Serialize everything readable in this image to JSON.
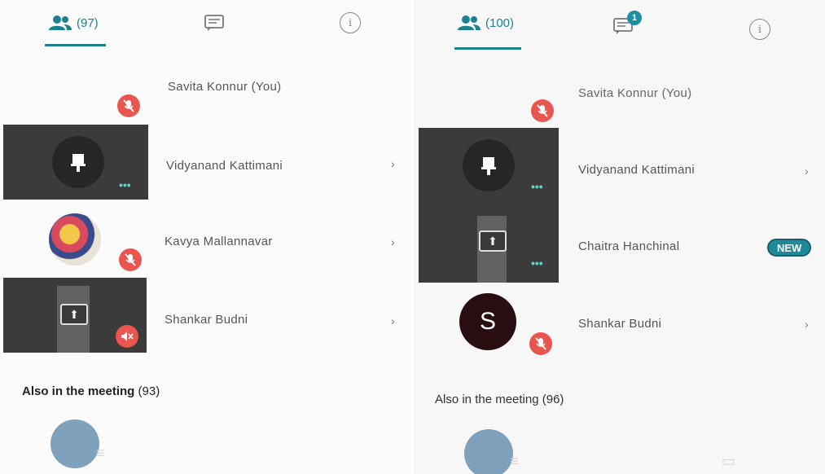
{
  "left": {
    "participants_tab": {
      "count": "(97)"
    },
    "participants": [
      {
        "name": "Savita Konnur (You)"
      },
      {
        "name": "Vidyanand Kattimani"
      },
      {
        "name": "Kavya Mallannavar"
      },
      {
        "name": "Shankar Budni"
      }
    ],
    "also_in_meeting": {
      "label": "Also in the meeting",
      "count": "(93)"
    }
  },
  "right": {
    "participants_tab": {
      "count": "(100)"
    },
    "chat_badge": "1",
    "participants": [
      {
        "name": "Savita Konnur (You)"
      },
      {
        "name": "Vidyanand Kattimani"
      },
      {
        "name": "Chaitra Hanchinal",
        "badge": "NEW"
      },
      {
        "name": "Shankar Budni",
        "avatar_letter": "S"
      }
    ],
    "also_in_meeting": {
      "label": "Also in the meeting",
      "count": "(96)"
    }
  },
  "colors": {
    "accent": "#1d7f90",
    "mute_red": "#e9564f",
    "tile_dark": "#3b3b3b"
  },
  "icons": [
    "people-icon",
    "chat-icon",
    "info-icon",
    "mic-off-icon",
    "hand-raise-icon",
    "screen-share-icon",
    "speaker-off-icon",
    "chevron-right-icon"
  ]
}
